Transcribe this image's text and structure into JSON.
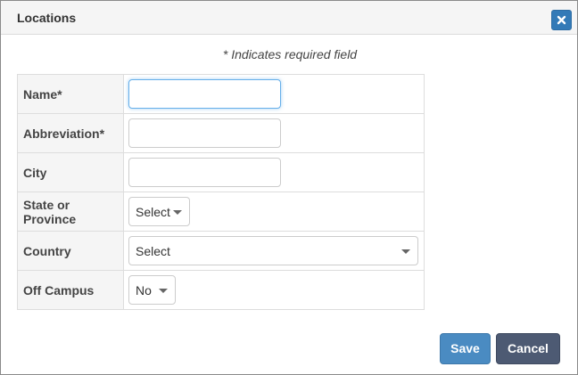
{
  "dialog": {
    "title": "Locations",
    "close_icon": "close-icon"
  },
  "form": {
    "required_note": "* Indicates required field",
    "rows": [
      {
        "label": "Name*",
        "type": "text",
        "value": "",
        "focused": true
      },
      {
        "label": "Abbreviation*",
        "type": "text",
        "value": ""
      },
      {
        "label": "City",
        "type": "text",
        "value": ""
      },
      {
        "label": "State or Province",
        "type": "select",
        "selected": "Select"
      },
      {
        "label": "Country",
        "type": "select",
        "selected": "Select"
      },
      {
        "label": "Off Campus",
        "type": "select",
        "selected": "No"
      }
    ]
  },
  "buttons": {
    "save_label": "Save",
    "cancel_label": "Cancel"
  },
  "colors": {
    "save": "#4a8bc2",
    "cancel": "#4d5a73",
    "close": "#337ab7",
    "focus_border": "#66afe9"
  }
}
